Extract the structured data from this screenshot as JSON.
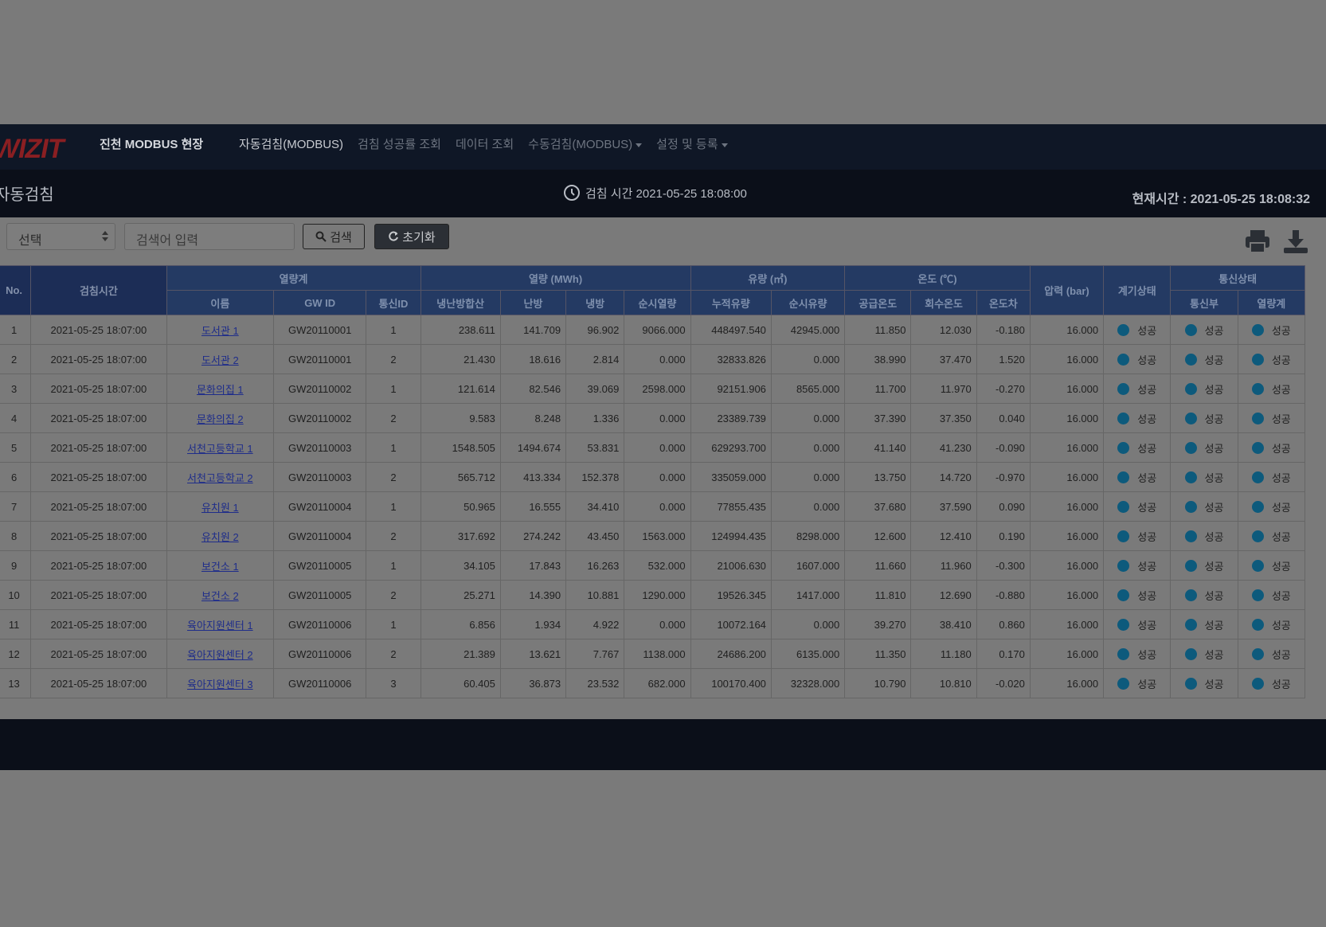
{
  "nav": {
    "logo": "WIZIT",
    "site": "진천 MODBUS 현장",
    "menu": [
      "자동검침(MODBUS)",
      "검침 성공률 조회",
      "데이터 조회",
      "수동검침(MODBUS)",
      "설정 및 등록"
    ]
  },
  "header": {
    "page_title": "자동검침",
    "reading_time": "검침 시간 2021-05-25 18:08:00",
    "current_time": "현재시간 : 2021-05-25 18:08:32"
  },
  "toolbar": {
    "select_value": "선택",
    "search_placeholder": "검색어 입력",
    "search_label": "검색",
    "reset_label": "초기화"
  },
  "table": {
    "group_headers": {
      "meter": "열량계",
      "heat": "열량 (MWh)",
      "flow": "유량 (㎥)",
      "temp": "온도 (℃)",
      "comm": "통신상태"
    },
    "headers": {
      "no": "No.",
      "time": "검침시간",
      "name": "이름",
      "gwid": "GW ID",
      "commid": "통신ID",
      "total": "냉난방합산",
      "heating": "난방",
      "cooling": "냉방",
      "inst_heat": "순시열량",
      "cum_flow": "누적유량",
      "inst_flow": "순시유량",
      "supply": "공급온도",
      "return": "회수온도",
      "diff": "온도차",
      "pressure": "압력 (bar)",
      "meter_state": "계기상태",
      "comm_unit": "통신부",
      "comm_meter": "열량계"
    },
    "rows": [
      {
        "no": "1",
        "time": "2021-05-25 18:07:00",
        "name": "도서관 1",
        "gwid": "GW20110001",
        "commid": "1",
        "total": "238.611",
        "heating": "141.709",
        "cooling": "96.902",
        "inst_heat": "9066.000",
        "cum_flow": "448497.540",
        "inst_flow": "42945.000",
        "supply": "11.850",
        "return": "12.030",
        "diff": "-0.180",
        "pressure": "16.000",
        "s1": "성공",
        "s2": "성공",
        "s3": "성공"
      },
      {
        "no": "2",
        "time": "2021-05-25 18:07:00",
        "name": "도서관 2",
        "gwid": "GW20110001",
        "commid": "2",
        "total": "21.430",
        "heating": "18.616",
        "cooling": "2.814",
        "inst_heat": "0.000",
        "cum_flow": "32833.826",
        "inst_flow": "0.000",
        "supply": "38.990",
        "return": "37.470",
        "diff": "1.520",
        "pressure": "16.000",
        "s1": "성공",
        "s2": "성공",
        "s3": "성공"
      },
      {
        "no": "3",
        "time": "2021-05-25 18:07:00",
        "name": "문화의집 1",
        "gwid": "GW20110002",
        "commid": "1",
        "total": "121.614",
        "heating": "82.546",
        "cooling": "39.069",
        "inst_heat": "2598.000",
        "cum_flow": "92151.906",
        "inst_flow": "8565.000",
        "supply": "11.700",
        "return": "11.970",
        "diff": "-0.270",
        "pressure": "16.000",
        "s1": "성공",
        "s2": "성공",
        "s3": "성공"
      },
      {
        "no": "4",
        "time": "2021-05-25 18:07:00",
        "name": "문화의집 2",
        "gwid": "GW20110002",
        "commid": "2",
        "total": "9.583",
        "heating": "8.248",
        "cooling": "1.336",
        "inst_heat": "0.000",
        "cum_flow": "23389.739",
        "inst_flow": "0.000",
        "supply": "37.390",
        "return": "37.350",
        "diff": "0.040",
        "pressure": "16.000",
        "s1": "성공",
        "s2": "성공",
        "s3": "성공"
      },
      {
        "no": "5",
        "time": "2021-05-25 18:07:00",
        "name": "서천고등학교 1",
        "gwid": "GW20110003",
        "commid": "1",
        "total": "1548.505",
        "heating": "1494.674",
        "cooling": "53.831",
        "inst_heat": "0.000",
        "cum_flow": "629293.700",
        "inst_flow": "0.000",
        "supply": "41.140",
        "return": "41.230",
        "diff": "-0.090",
        "pressure": "16.000",
        "s1": "성공",
        "s2": "성공",
        "s3": "성공"
      },
      {
        "no": "6",
        "time": "2021-05-25 18:07:00",
        "name": "서천고등학교 2",
        "gwid": "GW20110003",
        "commid": "2",
        "total": "565.712",
        "heating": "413.334",
        "cooling": "152.378",
        "inst_heat": "0.000",
        "cum_flow": "335059.000",
        "inst_flow": "0.000",
        "supply": "13.750",
        "return": "14.720",
        "diff": "-0.970",
        "pressure": "16.000",
        "s1": "성공",
        "s2": "성공",
        "s3": "성공"
      },
      {
        "no": "7",
        "time": "2021-05-25 18:07:00",
        "name": "유치원 1",
        "gwid": "GW20110004",
        "commid": "1",
        "total": "50.965",
        "heating": "16.555",
        "cooling": "34.410",
        "inst_heat": "0.000",
        "cum_flow": "77855.435",
        "inst_flow": "0.000",
        "supply": "37.680",
        "return": "37.590",
        "diff": "0.090",
        "pressure": "16.000",
        "s1": "성공",
        "s2": "성공",
        "s3": "성공"
      },
      {
        "no": "8",
        "time": "2021-05-25 18:07:00",
        "name": "유치원 2",
        "gwid": "GW20110004",
        "commid": "2",
        "total": "317.692",
        "heating": "274.242",
        "cooling": "43.450",
        "inst_heat": "1563.000",
        "cum_flow": "124994.435",
        "inst_flow": "8298.000",
        "supply": "12.600",
        "return": "12.410",
        "diff": "0.190",
        "pressure": "16.000",
        "s1": "성공",
        "s2": "성공",
        "s3": "성공"
      },
      {
        "no": "9",
        "time": "2021-05-25 18:07:00",
        "name": "보건소 1",
        "gwid": "GW20110005",
        "commid": "1",
        "total": "34.105",
        "heating": "17.843",
        "cooling": "16.263",
        "inst_heat": "532.000",
        "cum_flow": "21006.630",
        "inst_flow": "1607.000",
        "supply": "11.660",
        "return": "11.960",
        "diff": "-0.300",
        "pressure": "16.000",
        "s1": "성공",
        "s2": "성공",
        "s3": "성공"
      },
      {
        "no": "10",
        "time": "2021-05-25 18:07:00",
        "name": "보건소 2",
        "gwid": "GW20110005",
        "commid": "2",
        "total": "25.271",
        "heating": "14.390",
        "cooling": "10.881",
        "inst_heat": "1290.000",
        "cum_flow": "19526.345",
        "inst_flow": "1417.000",
        "supply": "11.810",
        "return": "12.690",
        "diff": "-0.880",
        "pressure": "16.000",
        "s1": "성공",
        "s2": "성공",
        "s3": "성공"
      },
      {
        "no": "11",
        "time": "2021-05-25 18:07:00",
        "name": "육아지원센터 1",
        "gwid": "GW20110006",
        "commid": "1",
        "total": "6.856",
        "heating": "1.934",
        "cooling": "4.922",
        "inst_heat": "0.000",
        "cum_flow": "10072.164",
        "inst_flow": "0.000",
        "supply": "39.270",
        "return": "38.410",
        "diff": "0.860",
        "pressure": "16.000",
        "s1": "성공",
        "s2": "성공",
        "s3": "성공"
      },
      {
        "no": "12",
        "time": "2021-05-25 18:07:00",
        "name": "육아지원센터 2",
        "gwid": "GW20110006",
        "commid": "2",
        "total": "21.389",
        "heating": "13.621",
        "cooling": "7.767",
        "inst_heat": "1138.000",
        "cum_flow": "24686.200",
        "inst_flow": "6135.000",
        "supply": "11.350",
        "return": "11.180",
        "diff": "0.170",
        "pressure": "16.000",
        "s1": "성공",
        "s2": "성공",
        "s3": "성공"
      },
      {
        "no": "13",
        "time": "2021-05-25 18:07:00",
        "name": "육아지원센터 3",
        "gwid": "GW20110006",
        "commid": "3",
        "total": "60.405",
        "heating": "36.873",
        "cooling": "23.532",
        "inst_heat": "682.000",
        "cum_flow": "100170.400",
        "inst_flow": "32328.000",
        "supply": "10.790",
        "return": "10.810",
        "diff": "-0.020",
        "pressure": "16.000",
        "s1": "성공",
        "s2": "성공",
        "s3": "성공"
      }
    ]
  },
  "colors": {
    "overlay_bg": "#7a7a7a",
    "navbar": "#0f1726",
    "header_bg": "#243a63",
    "status_dot": "#0d5a7c",
    "logo": "#8a1f22"
  }
}
